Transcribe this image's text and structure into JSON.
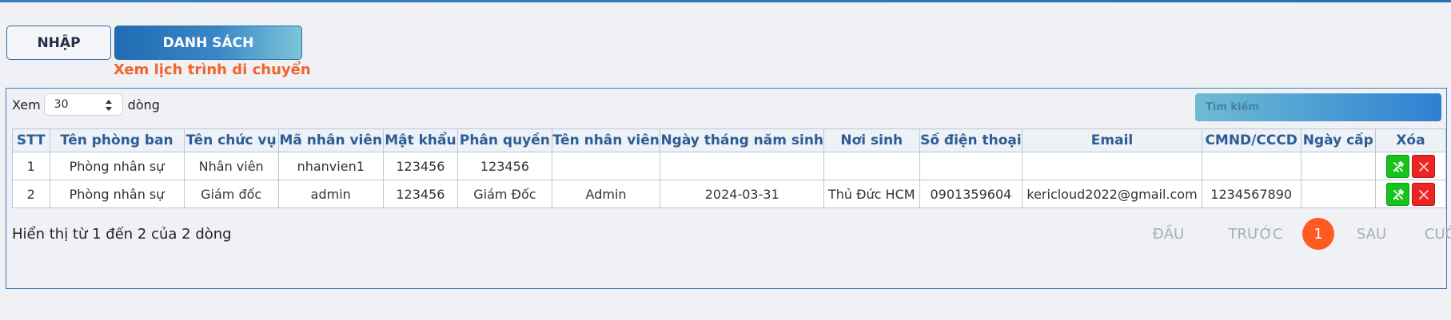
{
  "tabs": {
    "nhap": "NHẬP",
    "danh_sach": "DANH SÁCH"
  },
  "subtitle": "Xem lịch trình di chuyển",
  "length": {
    "prefix": "Xem",
    "value": "30",
    "suffix": "dòng"
  },
  "search": {
    "placeholder": "Tìm kiếm"
  },
  "table": {
    "headers": [
      "STT",
      "Tên phòng ban",
      "Tên chức vụ",
      "Mã nhân viên",
      "Mật khẩu",
      "Phân quyền",
      "Tên nhân viên",
      "Ngày tháng năm sinh",
      "Nơi sinh",
      "Số điện thoại",
      "Email",
      "CMND/CCCD",
      "Ngày cấp",
      "Xóa"
    ],
    "rows": [
      [
        "1",
        "Phòng nhân sự",
        "Nhân viên",
        "nhanvien1",
        "123456",
        "123456",
        "",
        "",
        "",
        "",
        "",
        "",
        ""
      ],
      [
        "2",
        "Phòng nhân sự",
        "Giám đốc",
        "admin",
        "123456",
        "Giám Đốc",
        "Admin",
        "2024-03-31",
        "Thủ Đức HCM",
        "0901359604",
        "kericloud2022@gmail.com",
        "1234567890",
        ""
      ]
    ]
  },
  "info": "Hiển thị từ 1 đến 2 của 2 dòng",
  "pagination": {
    "first": "ĐẦU",
    "prev": "TRƯỚC",
    "current": "1",
    "next": "SAU",
    "last": "CUỐI"
  },
  "icons": {
    "edit": "edit-tool-icon",
    "delete": "close-icon"
  },
  "colors": {
    "accent": "#1f6cb3",
    "subtitle": "#f5622a",
    "current_page": "#ff5a22",
    "edit_button": "#17c21c",
    "delete_button": "#ec2424"
  }
}
